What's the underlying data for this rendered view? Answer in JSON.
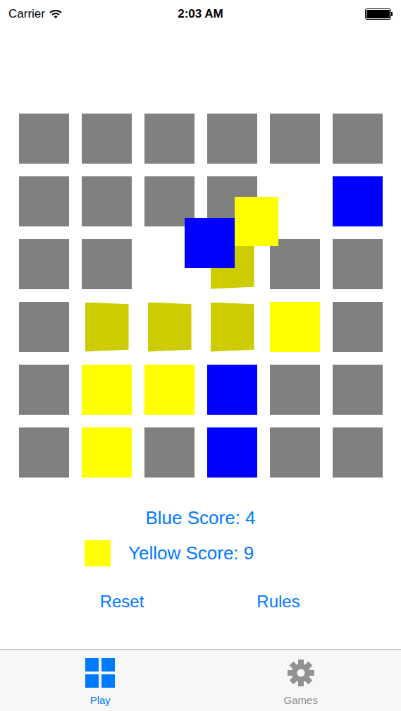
{
  "status_bar": {
    "carrier": "Carrier",
    "time": "2:03 AM"
  },
  "board": {
    "rows": [
      [
        {
          "kind": "tile",
          "color": "#808080"
        },
        {
          "kind": "tile",
          "color": "#808080"
        },
        {
          "kind": "tile",
          "color": "#808080"
        },
        {
          "kind": "tile",
          "color": "#808080"
        },
        {
          "kind": "tile",
          "color": "#808080"
        },
        {
          "kind": "tile",
          "color": "#808080"
        }
      ],
      [
        {
          "kind": "tile",
          "color": "#808080"
        },
        {
          "kind": "tile",
          "color": "#808080"
        },
        {
          "kind": "tile",
          "color": "#808080"
        },
        {
          "kind": "tile",
          "color": "#808080"
        },
        {
          "kind": "empty"
        },
        {
          "kind": "tile",
          "color": "#0000ff"
        }
      ],
      [
        {
          "kind": "tile",
          "color": "#808080"
        },
        {
          "kind": "tile",
          "color": "#808080"
        },
        {
          "kind": "empty"
        },
        {
          "kind": "flipping",
          "color": "#cccc00"
        },
        {
          "kind": "tile",
          "color": "#808080"
        },
        {
          "kind": "tile",
          "color": "#808080"
        }
      ],
      [
        {
          "kind": "tile",
          "color": "#808080"
        },
        {
          "kind": "flipping",
          "color": "#cccc00"
        },
        {
          "kind": "flipping",
          "color": "#cccc00"
        },
        {
          "kind": "flipping",
          "color": "#cccc00"
        },
        {
          "kind": "tile",
          "color": "#ffff00"
        },
        {
          "kind": "tile",
          "color": "#808080"
        }
      ],
      [
        {
          "kind": "tile",
          "color": "#808080"
        },
        {
          "kind": "tile",
          "color": "#ffff00"
        },
        {
          "kind": "tile",
          "color": "#ffff00"
        },
        {
          "kind": "tile",
          "color": "#0000ff"
        },
        {
          "kind": "tile",
          "color": "#808080"
        },
        {
          "kind": "tile",
          "color": "#808080"
        }
      ],
      [
        {
          "kind": "tile",
          "color": "#808080"
        },
        {
          "kind": "tile",
          "color": "#ffff00"
        },
        {
          "kind": "tile",
          "color": "#808080"
        },
        {
          "kind": "tile",
          "color": "#0000ff"
        },
        {
          "kind": "tile",
          "color": "#808080"
        },
        {
          "kind": "tile",
          "color": "#808080"
        }
      ]
    ],
    "moving": [
      {
        "color": "#ffff00"
      },
      {
        "color": "#0000ff"
      }
    ]
  },
  "scores": [
    {
      "label": "Blue Score: 4",
      "turn": false,
      "color": "#0000ff"
    },
    {
      "label": "Yellow Score: 9",
      "turn": true,
      "color": "#ffff00"
    }
  ],
  "buttons": [
    "Reset",
    "Rules"
  ],
  "tabs": [
    {
      "label": "Play",
      "selected": true
    },
    {
      "label": "Games",
      "selected": false
    }
  ]
}
